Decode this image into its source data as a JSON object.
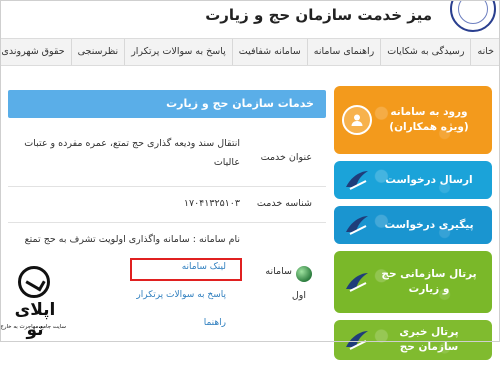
{
  "header": {
    "title": "میز خدمت سازمان حج و زیارت"
  },
  "nav": {
    "items": [
      "خانه",
      "رسیدگی به شکایات",
      "راهنمای سامانه",
      "سامانه شفافیت",
      "پاسخ به سوالات پرتکرار",
      "نظرسنجی",
      "حقوق شهروندی"
    ]
  },
  "sidebar": {
    "items": [
      {
        "label": "ورود به سامانه (ویژه همکاران)",
        "color": "#f39a1c"
      },
      {
        "label": "ارسال درخواست",
        "color": "#1ba3d9"
      },
      {
        "label": "پیگیری درخواست",
        "color": "#1a95d0"
      },
      {
        "label": "پرتال سازمانی حج و زیارت",
        "color": "#7ab829"
      },
      {
        "label": "پرتال خبری سازمان حج",
        "color": "#80bb2f"
      }
    ]
  },
  "main": {
    "heading": "خدمات سازمان حج و زیارت",
    "service_title_label": "عنوان خدمت",
    "service_title_value": "انتقال سند ودیعه گذاری حج تمتع، عمره مفرده و عتبات عالیات",
    "service_id_label": "شناسه خدمت",
    "service_id_value": "۱۷۰۴۱۳۲۵۱۰۳",
    "system_name": "نام سامانه : سامانه واگذاری اولویت تشرف به حج تمتع",
    "system_label": "سامانه",
    "first_label": "اول",
    "link_system": "لینک سامانه",
    "link_faq": "پاسخ به سوالات پرتکرار",
    "link_guide": "راهنما"
  },
  "watermark": {
    "brand": "اپلای تو",
    "tagline": "سایت جامع مهاجرت به خارج از کشور"
  },
  "colors": {
    "heading_bar": "#5aaee8",
    "highlight": "#e02020",
    "link": "#2f7fbf"
  }
}
